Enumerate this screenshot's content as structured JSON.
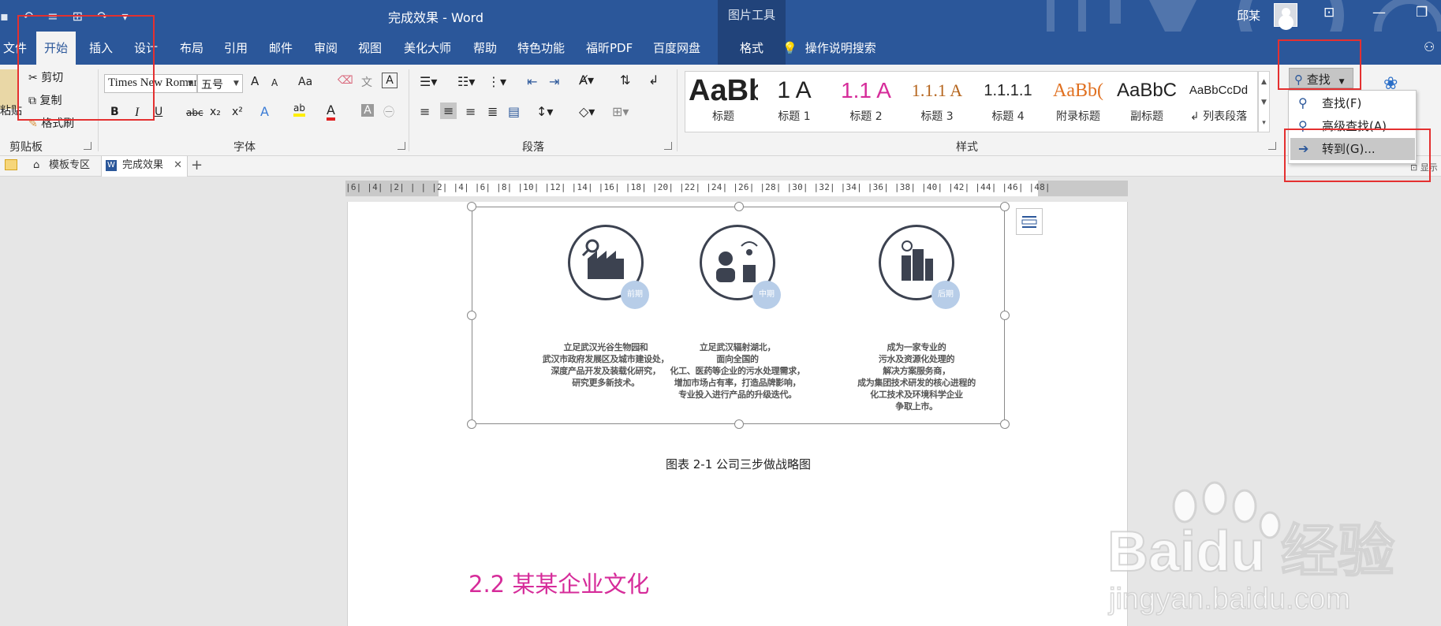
{
  "window": {
    "title": "完成效果 - Word",
    "picture_tools": "图片工具",
    "user": "邱某"
  },
  "tabs": [
    "文件",
    "开始",
    "插入",
    "设计",
    "布局",
    "引用",
    "邮件",
    "审阅",
    "视图",
    "美化大师",
    "帮助",
    "特色功能",
    "福昕PDF",
    "百度网盘",
    "格式"
  ],
  "tell_me": "操作说明搜索",
  "clipboard": {
    "paste": "粘贴",
    "cut": "剪切",
    "copy": "复制",
    "format_painter": "格式刷",
    "label": "剪贴板"
  },
  "font": {
    "name": "Times New Roman",
    "size": "五号",
    "grow": "A",
    "shrink": "A",
    "case": "Aa",
    "bold": "B",
    "italic": "I",
    "underline": "U",
    "strike": "abc",
    "sub": "x₂",
    "sup": "x²",
    "color_a": "A",
    "label": "字体"
  },
  "paragraph": {
    "label": "段落"
  },
  "styles": {
    "label": "样式",
    "items": [
      {
        "sample": "AaBb",
        "name": "标题",
        "color": "#111111"
      },
      {
        "sample": "1   A",
        "name": "标题 1",
        "color": "#111111"
      },
      {
        "sample": "1.1  A",
        "name": "标题 2",
        "color": "#d62c9a"
      },
      {
        "sample": "1.1.1  A",
        "name": "标题 3",
        "color": "#b5651d"
      },
      {
        "sample": "1.1.1.1",
        "name": "标题 4",
        "color": "#111111"
      },
      {
        "sample": "AaBb(",
        "name": "附录标题",
        "color": "#e07020"
      },
      {
        "sample": "AaBbC",
        "name": "副标题",
        "color": "#111111"
      },
      {
        "sample": "AaBbCcDd",
        "name": "↲ 列表段落",
        "color": "#111111"
      }
    ]
  },
  "editing": {
    "find_button": "查找",
    "menu": [
      "查找(F)",
      "高级查找(A)...",
      "转到(G)..."
    ]
  },
  "doc_tabs": [
    "模板专区",
    "完成效果"
  ],
  "ruler": "|6|  |4|  |2|  | |  |2|  |4|  |6|  |8|  |10|  |12|  |14|  |16|  |18|  |20|  |22|  |24|  |26|  |28|  |30|  |32|  |34|  |36|  |38|  |40|  |42|  |44|  |46|  |48|",
  "figure": {
    "stages": [
      {
        "badge": "前期",
        "desc": [
          "立足武汉光谷生物园和",
          "武汉市政府发展区及城市建设处，",
          "深度产品开发及装载化研究，",
          "研究更多新技术。"
        ]
      },
      {
        "badge": "中期",
        "desc": [
          "立足武汉辐射湖北，",
          "面向全国的",
          "化工、医药等企业的污水处理需求，",
          "增加市场占有率，打造品牌影响，",
          "专业投入进行产品的升级迭代。"
        ]
      },
      {
        "badge": "后期",
        "desc": [
          "成为一家专业的",
          "污水及资源化处理的",
          "解决方案服务商，",
          "成为集团技术研发的核心进程的",
          "化工技术及环境科学企业",
          "争取上市。"
        ]
      }
    ],
    "caption": "图表 2-1 公司三步做战略图"
  },
  "heading": "2.2 某某企业文化",
  "watermark": {
    "brand": "Baidu 经验",
    "url": "jingyan.baidu.com"
  },
  "colors": {
    "brand_blue": "#2b579a",
    "heading_pink": "#d62c9a",
    "annotation_red": "#e43030"
  }
}
